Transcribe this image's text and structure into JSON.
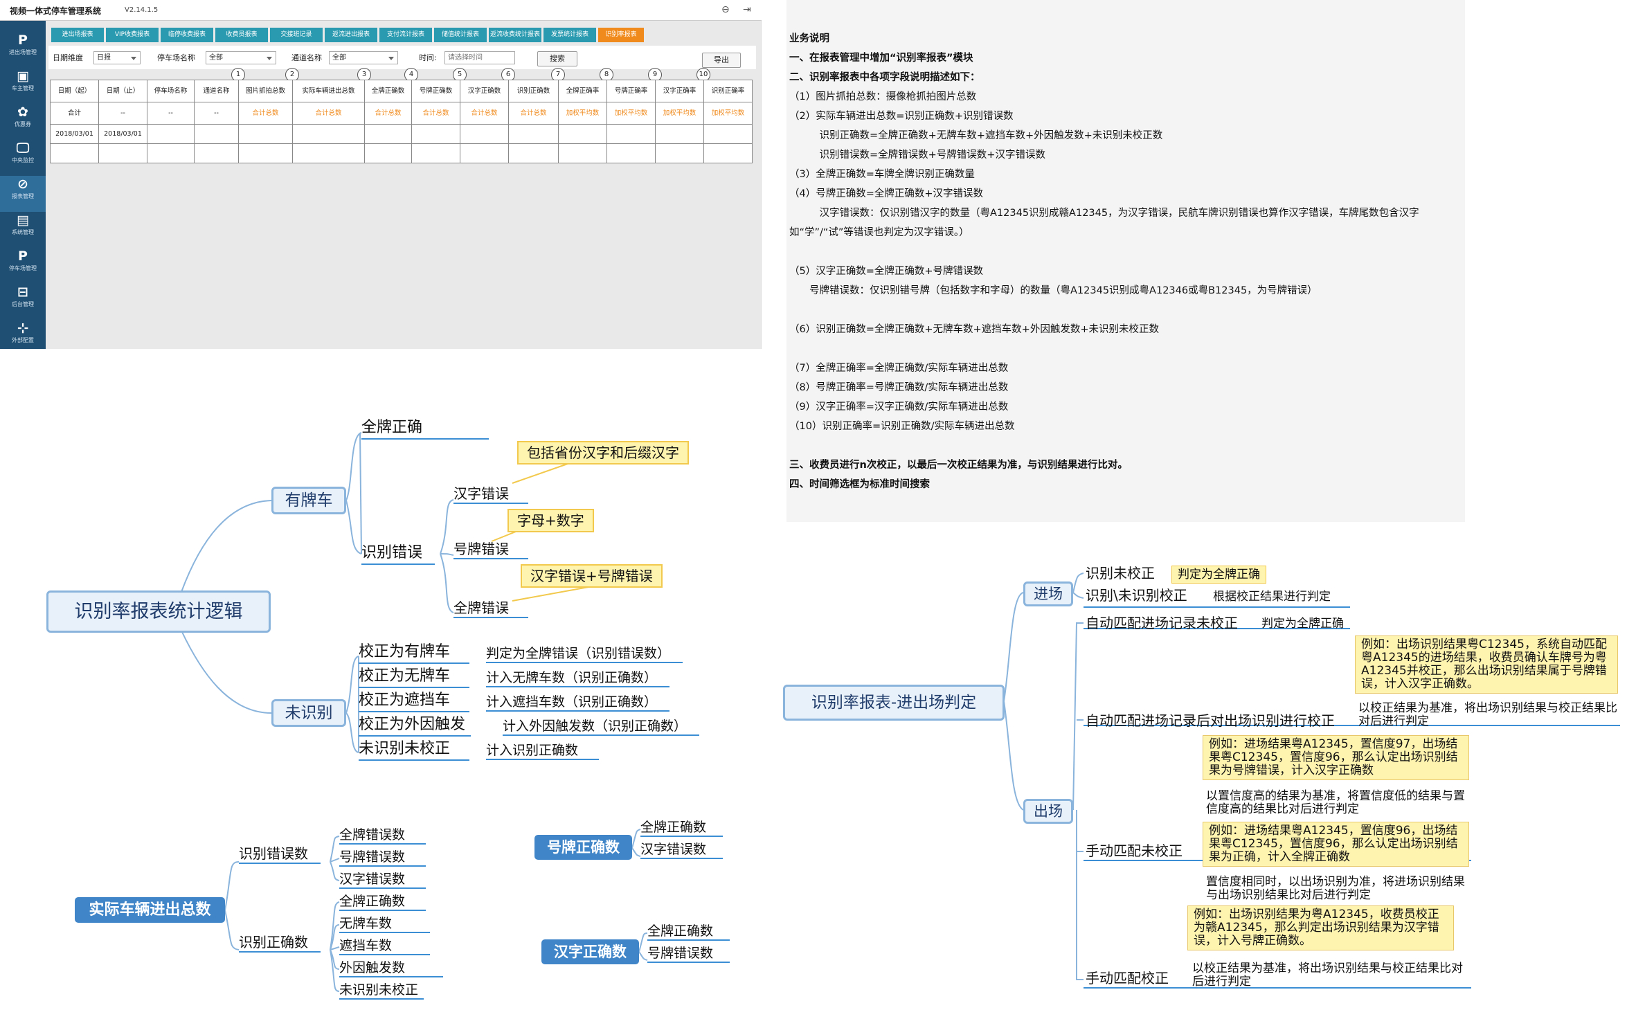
{
  "app": {
    "title": "视频一体式停车管理系统",
    "version": "V2.14.1.5",
    "sidebar": [
      {
        "icon": "P",
        "label": "进出场管理"
      },
      {
        "icon": "▣",
        "label": "车主管理"
      },
      {
        "icon": "✿",
        "label": "优惠券"
      },
      {
        "icon": "🖵",
        "label": "中央监控"
      },
      {
        "icon": "⊘",
        "label": "报表管理"
      },
      {
        "icon": "▤",
        "label": "系统管理"
      },
      {
        "icon": "P",
        "label": "停车场管理"
      },
      {
        "icon": "⊟",
        "label": "后台管理"
      },
      {
        "icon": "⊹",
        "label": "外部配置"
      }
    ],
    "tabs": [
      "进出场报表",
      "VIP收费报表",
      "临停收费报表",
      "收费员报表",
      "交接班记录",
      "返流进出报表",
      "支付流计报表",
      "储值统计报表",
      "返流收费统计报表",
      "发票统计报表",
      "识别率报表"
    ],
    "filters": {
      "granularity_label": "日期维度",
      "granularity_value": "日报",
      "lot_label": "停车场名称",
      "lot_value": "全部",
      "channel_label": "通道名称",
      "channel_value": "全部",
      "time_label": "时间:",
      "time_placeholder": "请选择时间",
      "search": "搜索",
      "export": "导出"
    },
    "columns": [
      "日期（起）",
      "日期（止）",
      "停车场名称",
      "通道名称",
      "图片抓拍总数",
      "实际车辆进出总数",
      "全牌正确数",
      "号牌正确数",
      "汉字正确数",
      "识别正确数",
      "全牌正确率",
      "号牌正确率",
      "汉字正确率",
      "识别正确率"
    ],
    "col_numbers": [
      "1",
      "2",
      "3",
      "4",
      "5",
      "6",
      "7",
      "8",
      "9",
      "10"
    ],
    "total_row": [
      "合计",
      "--",
      "--",
      "--",
      "合计总数",
      "合计总数",
      "合计总数",
      "合计总数",
      "合计总数",
      "合计总数",
      "加权平均数",
      "加权平均数",
      "加权平均数",
      "加权平均数"
    ],
    "data_row": [
      "2018/03/01",
      "2018/03/01",
      "",
      "",
      "",
      "",
      "",
      "",
      "",
      "",
      "",
      "",
      "",
      ""
    ]
  },
  "spec": {
    "lines": [
      "业务说明",
      "一、在报表管理中增加“识别率报表”模块",
      "二、识别率报表中各项字段说明描述如下：",
      "（1）图片抓拍总数：摄像枪抓拍图片总数",
      "（2）实际车辆进出总数=识别正确数+识别错误数",
      "　　　识别正确数=全牌正确数+无牌车数+遮挡车数+外因触发数+未识别未校正数",
      "　　　识别错误数=全牌错误数+号牌错误数+汉字错误数",
      "（3）全牌正确数=车牌全牌识别正确数量",
      "（4）号牌正确数=全牌正确数+汉字错误数",
      "　　　汉字错误数：仅识别错汉字的数量（粤A12345识别成赣A12345，为汉字错误，民航车牌识别错误也算作汉字错误，车牌尾数包含汉字",
      "如“学”/“试”等错误也判定为汉字错误。）",
      "",
      "（5）汉字正确数=全牌正确数+号牌错误数",
      "　　号牌错误数：仅识别错号牌（包括数字和字母）的数量（粤A12345识别成粤A12346或粤B12345，为号牌错误）",
      "",
      "（6）识别正确数=全牌正确数+无牌车数+遮挡车数+外因触发数+未识别未校正数",
      "",
      "（7）全牌正确率=全牌正确数/实际车辆进出总数",
      "（8）号牌正确率=号牌正确数/实际车辆进出总数",
      "（9）汉字正确率=汉字正确数/实际车辆进出总数",
      "（10）识别正确率=识别正确数/实际车辆进出总数",
      "",
      "三、收费员进行n次校正，以最后一次校正结果为准，与识别结果进行比对。",
      "四、时间筛选框为标准时间搜索"
    ]
  },
  "mm1": {
    "root": "识别率报表统计逻辑",
    "plate": "有牌车",
    "unrec": "未识别",
    "full_correct": "全牌正确",
    "rec_error": "识别错误",
    "hz_err": "汉字错误",
    "hp_err": "号牌错误",
    "qp_err": "全牌错误",
    "note_hz": "包括省份汉字和后缀汉字",
    "note_hp": "字母+数字",
    "note_qp": "汉字错误+号牌错误",
    "un": [
      {
        "k": "校正为有牌车",
        "v": "判定为全牌错误（识别错误数）"
      },
      {
        "k": "校正为无牌车",
        "v": "计入无牌车数（识别正确数）"
      },
      {
        "k": "校正为遮挡车",
        "v": "计入遮挡车数（识别正确数）"
      },
      {
        "k": "校正为外因触发",
        "v": "计入外因触发数（识别正确数）"
      },
      {
        "k": "未识别未校正",
        "v": "计入识别正确数"
      }
    ]
  },
  "mm2": {
    "root": "实际车辆进出总数",
    "err": "识别错误数",
    "ok": "识别正确数",
    "err_items": [
      "全牌错误数",
      "号牌错误数",
      "汉字错误数"
    ],
    "ok_items": [
      "全牌正确数",
      "无牌车数",
      "遮挡车数",
      "外因触发数",
      "未识别未校正"
    ]
  },
  "mm3": {
    "root": "号牌正确数",
    "items": [
      "全牌正确数",
      "汉字错误数"
    ]
  },
  "mm4": {
    "root": "汉字正确数",
    "items": [
      "全牌正确数",
      "号牌错误数"
    ]
  },
  "mm5": {
    "root": "识别率报表-进出场判定",
    "entry": "进场",
    "exit": "出场",
    "e1": "识别未校正",
    "e1v": "判定为全牌正确",
    "e2": "识别\\未识别校正",
    "e2v": "根据校正结果进行判定",
    "x1": "自动匹配进场记录未校正",
    "x1v": "判定为全牌正确",
    "x2": "自动匹配进场记录后对出场识别进行校正",
    "x2n": "例如：出场识别结果粤C12345，系统自动匹配粤A12345的进场结果，收费员确认车牌号为粤A12345并校正，那么出场识别结果属于号牌错误，计入汉字正确数。",
    "x2v": "以校正结果为基准，将出场识别结果与校正结果比对后进行判定",
    "x3": "手动匹配未校正",
    "x3n1": "例如：进场结果粤A12345，置信度97，出场结果粤C12345，置信度96，那么认定出场识别结果为号牌错误，计入汉字正确数",
    "x3v1": "以置信度高的结果为基准，将置信度低的结果与置信度高的结果比对后进行判定",
    "x3n2": "例如：进场结果粤A12345，置信度96，出场结果粤C12345，置信度96，那么认定出场识别结果为正确，计入全牌正确数",
    "x3v2": "置信度相同时，以出场识别为准，将进场识别结果与出场识别结果比对后进行判定",
    "x4": "手动匹配校正",
    "x4n": "例如：出场识别结果为粤A12345，收费员校正为赣A12345，那么判定出场识别结果为汉字错误，计入号牌正确数。",
    "x4v": "以校正结果为基准，将出场识别结果与校正结果比对后进行判定"
  }
}
